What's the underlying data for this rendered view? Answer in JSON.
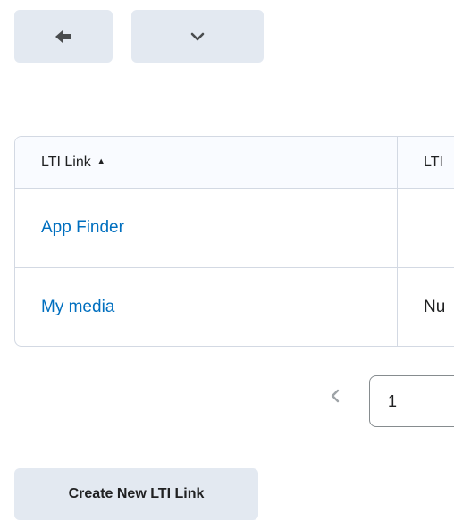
{
  "toolbar": {
    "back_icon": "arrow-left-icon",
    "more_icon": "chevron-down-icon"
  },
  "table": {
    "columns": [
      {
        "label": "LTI Link",
        "sort": "ascending"
      },
      {
        "label": "LTI"
      }
    ],
    "rows": [
      {
        "link": "App Finder",
        "value": ""
      },
      {
        "link": "My media",
        "value": "Nu"
      }
    ]
  },
  "pagination": {
    "prev_icon": "chevron-left-icon",
    "current_page": "1"
  },
  "actions": {
    "create_label": "Create New LTI Link"
  },
  "colors": {
    "link": "#006fbf",
    "button_bg": "#e3e9f1",
    "border": "#d3d9e3"
  }
}
